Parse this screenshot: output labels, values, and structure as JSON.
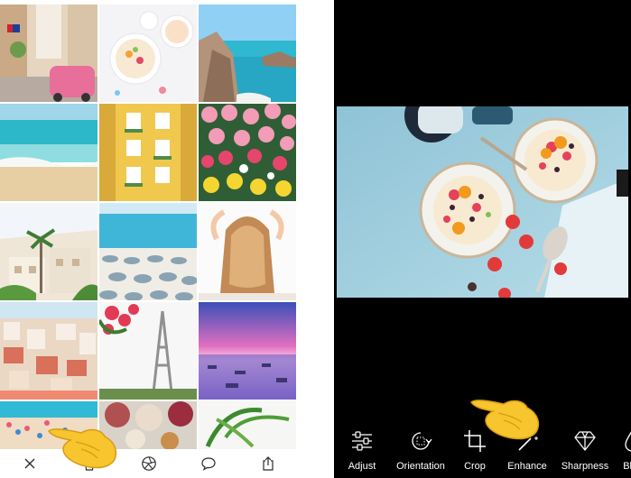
{
  "gallery": {
    "tiles": [
      {
        "name": "tile-havana-street"
      },
      {
        "name": "tile-breakfast-bowls"
      },
      {
        "name": "tile-rocky-coast"
      },
      {
        "name": "tile-beach-waves"
      },
      {
        "name": "tile-yellow-building"
      },
      {
        "name": "tile-flower-market"
      },
      {
        "name": "tile-palm-villas"
      },
      {
        "name": "tile-beach-umbrellas"
      },
      {
        "name": "tile-woman-hair"
      },
      {
        "name": "tile-coastal-town"
      },
      {
        "name": "tile-eiffel-tower"
      },
      {
        "name": "tile-sunset-sea"
      },
      {
        "name": "tile-beach-crowd"
      },
      {
        "name": "tile-food-spread"
      },
      {
        "name": "tile-palm-leaves"
      }
    ],
    "toolbar": [
      {
        "name": "close-button",
        "icon": "close-icon"
      },
      {
        "name": "delete-button",
        "icon": "trash-icon"
      },
      {
        "name": "edit-button",
        "icon": "aperture-icon"
      },
      {
        "name": "comment-button",
        "icon": "speech-bubble-icon"
      },
      {
        "name": "share-button",
        "icon": "share-icon"
      }
    ]
  },
  "editor": {
    "tools": [
      {
        "label": "Adjust",
        "icon": "sliders-icon"
      },
      {
        "label": "Orientation",
        "icon": "rotate-icon"
      },
      {
        "label": "Crop",
        "icon": "crop-icon"
      },
      {
        "label": "Enhance",
        "icon": "magic-wand-icon"
      },
      {
        "label": "Sharpness",
        "icon": "diamond-icon"
      },
      {
        "label": "Blur",
        "icon": "drop-icon"
      }
    ]
  },
  "colors": {
    "editor_bg": "#000000",
    "text_light": "#ffffff",
    "hand": "#f7c52d"
  }
}
